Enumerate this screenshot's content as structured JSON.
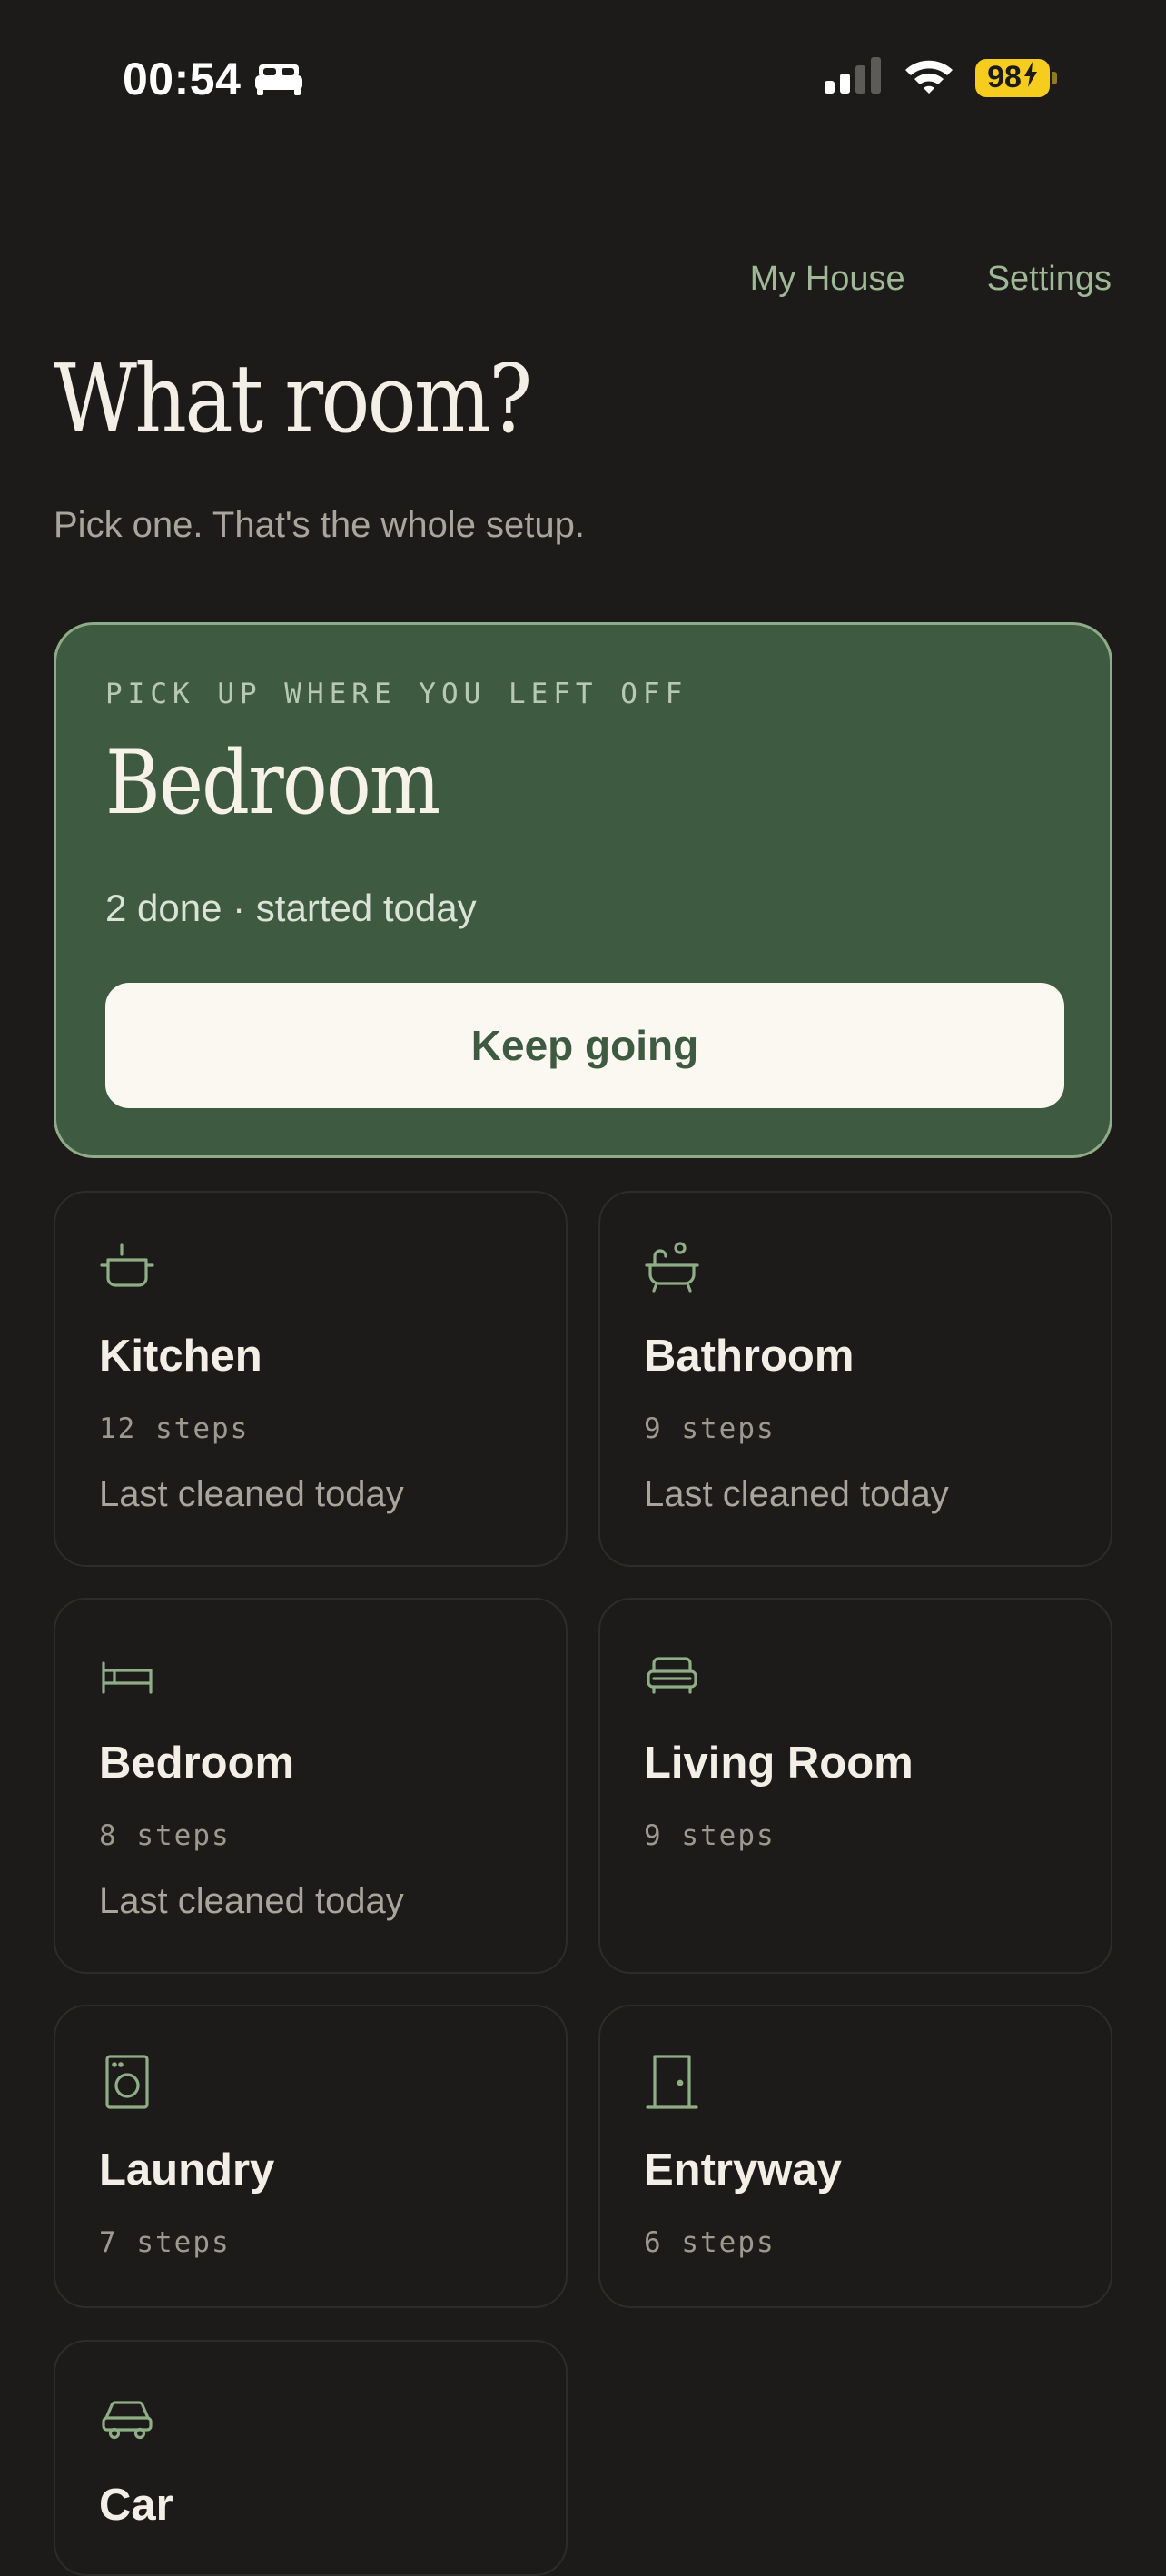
{
  "status_bar": {
    "time": "00:54",
    "battery": "98",
    "sleep_icon": "bed-icon",
    "signal_icon": "cellular-signal-icon",
    "wifi_icon": "wifi-icon"
  },
  "nav": {
    "my_house": "My House",
    "settings": "Settings"
  },
  "header": {
    "title": "What room?",
    "subtitle": "Pick one. That's the whole setup."
  },
  "resume": {
    "eyebrow": "PICK UP WHERE YOU LEFT OFF",
    "room": "Bedroom",
    "meta": "2 done · started today",
    "button_label": "Keep going"
  },
  "rooms": [
    {
      "name": "Kitchen",
      "steps": "12 steps",
      "last": "Last cleaned today",
      "icon": "pot-icon"
    },
    {
      "name": "Bathroom",
      "steps": "9 steps",
      "last": "Last cleaned today",
      "icon": "bathtub-icon"
    },
    {
      "name": "Bedroom",
      "steps": "8 steps",
      "last": "Last cleaned today",
      "icon": "bed-icon"
    },
    {
      "name": "Living Room",
      "steps": "9 steps",
      "last": "",
      "icon": "sofa-icon"
    },
    {
      "name": "Laundry",
      "steps": "7 steps",
      "last": "",
      "icon": "washing-machine-icon"
    },
    {
      "name": "Entryway",
      "steps": "6 steps",
      "last": "",
      "icon": "door-icon"
    },
    {
      "name": "Car",
      "steps": "",
      "last": "",
      "icon": "car-icon"
    }
  ],
  "colors": {
    "background": "#1c1b19",
    "accent_green": "#3e5b41",
    "accent_border": "#8fac88",
    "icon_green": "#8fae86",
    "battery": "#f6cc1e"
  }
}
